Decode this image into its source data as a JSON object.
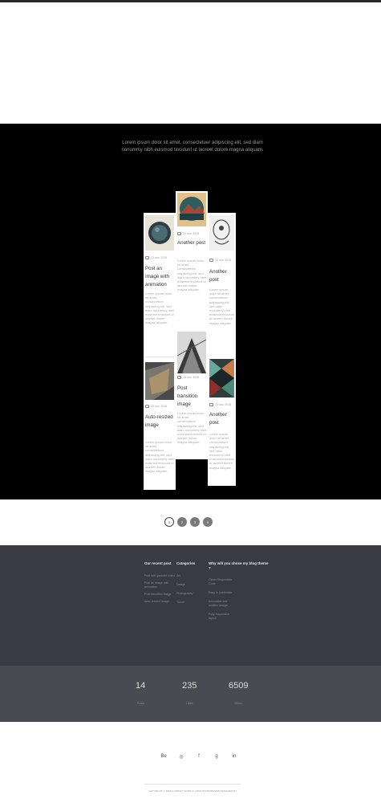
{
  "intro": {
    "text": "Lorem ipsum dolor sit amet, consectetuer adipiscing elit, sed diam nonummy nibh euismod tincidunt ut laoreet dolore magna aliquam."
  },
  "posts": {
    "col1": [
      {
        "date": "23 nov, 2015",
        "title": "Post an Image with animation",
        "excerpt": "Lorem ipsum dolor sit amet, consectetuer adipiscing elit, sed diam nonummy nibh euismod tincidunt ut laoreet dolore magna aliquam."
      },
      {
        "date": "23 nov, 2015",
        "title": "Auto-resized image",
        "excerpt": "Lorem ipsum dolor sit amet, consectetuer adipiscing elit, sed diam nonummy nibh euismod tincidunt ut laoreet dolore magna aliquam."
      }
    ],
    "col2": [
      {
        "date": "23 nov, 2015",
        "title": "Another post",
        "excerpt": "Lorem ipsum dolor sit amet, consectetuer adipiscing elit, sed diam nonummy nibh euismod tincidunt ut laoreet dolore magna aliquam."
      },
      {
        "date": "18 nov, 2015",
        "title": "Post transition image",
        "excerpt": "Lorem ipsum dolor sit amet, consectetuer adipiscing elit, sed diam nonummy nibh euismod tincidunt ut laoreet dolore magna aliquam."
      }
    ],
    "col3": [
      {
        "date": "23 nov, 2015",
        "title": "Another post",
        "excerpt": "Lorem ipsum dolor sit amet, consectetuer adipiscing elit, sed diam nonummy nibh euismod tincidunt ut laoreet dolore magna aliquam."
      },
      {
        "date": "23 nov, 2015",
        "title": "Another post",
        "excerpt": "Lorem ipsum dolor sit amet, consectetuer adipiscing elit, sed diam nonummy nibh euismod tincidunt ut laoreet dolore magna aliquam."
      }
    ]
  },
  "pagination": [
    "1",
    "2",
    "3",
    "4"
  ],
  "footer": {
    "recent_heading": "Our recent post",
    "recent_items": [
      "Post with youtube video",
      "Post an image with animation",
      "Post transition image",
      "Auto-resized image"
    ],
    "categories_heading": "Categories",
    "categories": [
      "Art",
      "Design",
      "Photography",
      "Travel"
    ],
    "why_heading": "Why will you chose my blog theme ?",
    "why_items": [
      "Clean Responsive Code",
      "Easy to customize",
      "Innovative and modern design",
      "Fully responsive layout"
    ]
  },
  "stats": [
    {
      "value": "14",
      "label": "Posts"
    },
    {
      "value": "235",
      "label": "Likes"
    },
    {
      "value": "6509",
      "label": "Views"
    }
  ],
  "social": [
    "Be",
    "◎",
    "f",
    "g",
    "in"
  ],
  "copyright": {
    "prefix": "COPYRIGHT © 2016 COMPANY NAME ALL RIGHTS RESERVED",
    "suffix": "DESIGNED BY"
  }
}
